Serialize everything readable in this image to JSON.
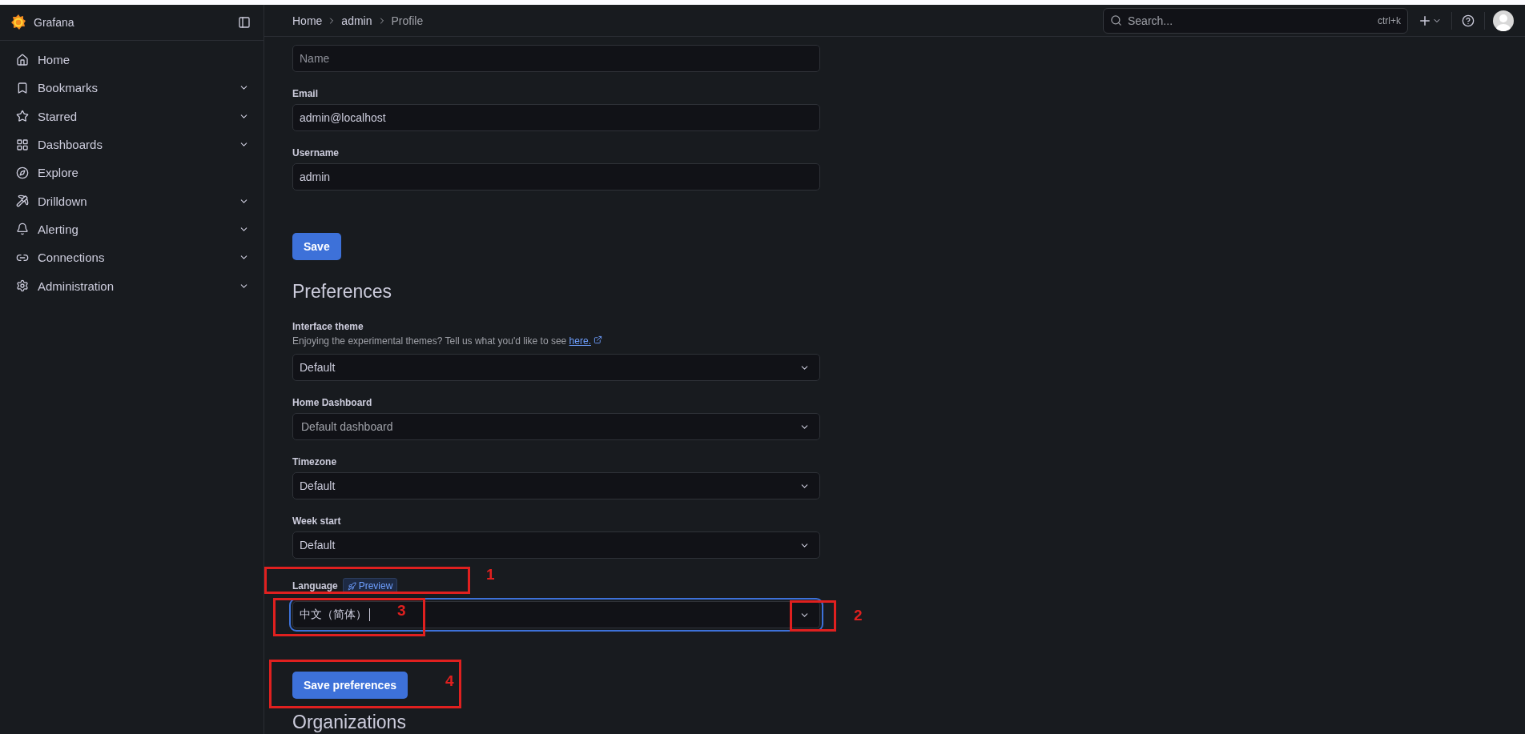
{
  "brand": {
    "name": "Grafana"
  },
  "nav": [
    {
      "label": "Home",
      "expandable": false
    },
    {
      "label": "Bookmarks",
      "expandable": true
    },
    {
      "label": "Starred",
      "expandable": true
    },
    {
      "label": "Dashboards",
      "expandable": true
    },
    {
      "label": "Explore",
      "expandable": false
    },
    {
      "label": "Drilldown",
      "expandable": true
    },
    {
      "label": "Alerting",
      "expandable": true
    },
    {
      "label": "Connections",
      "expandable": true
    },
    {
      "label": "Administration",
      "expandable": true
    }
  ],
  "breadcrumb": [
    {
      "label": "Home",
      "current": false
    },
    {
      "label": "admin",
      "current": false
    },
    {
      "label": "Profile",
      "current": true
    }
  ],
  "search": {
    "placeholder": "Search...",
    "shortcut": "ctrl+k"
  },
  "profile_fields": [
    {
      "label": "Email",
      "value": "admin@localhost"
    },
    {
      "label": "Username",
      "value": "admin"
    }
  ],
  "name_field": {
    "placeholder": "Name"
  },
  "save_button": "Save",
  "preferences": {
    "title": "Preferences",
    "theme": {
      "label": "Interface theme",
      "description": "Enjoying the experimental themes? Tell us what you'd like to see",
      "link": "here.",
      "value": "Default"
    },
    "selects": [
      {
        "label": "Home Dashboard",
        "value": "Default dashboard",
        "placeholder": true
      },
      {
        "label": "Timezone",
        "value": "Default",
        "placeholder": false
      },
      {
        "label": "Week start",
        "value": "Default",
        "placeholder": false
      }
    ],
    "language": {
      "label": "Language",
      "badge": "Preview",
      "value": "中文（简体）",
      "focused": true
    },
    "save_button": "Save preferences"
  },
  "organizations_title": "Organizations",
  "annotations": [
    {
      "label": "1"
    },
    {
      "label": "3"
    },
    {
      "label": "2"
    },
    {
      "label": "4"
    }
  ]
}
